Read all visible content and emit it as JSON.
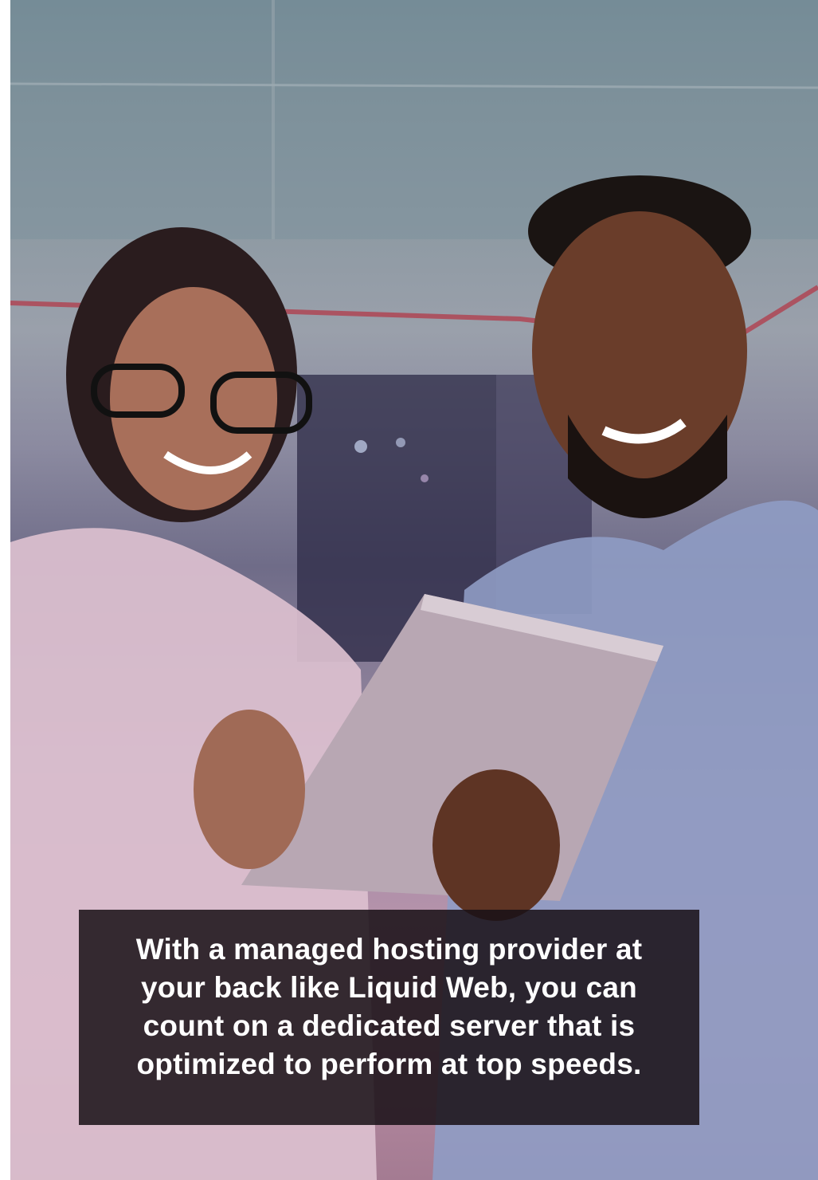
{
  "photo": {
    "subject": "two colleagues looking at a tablet in a server room",
    "icon": "photo-image"
  },
  "caption": {
    "text": "With a managed hosting provider at your back like Liquid Web, you can count on a dedicated server that is optimized to perform at top speeds."
  },
  "colors": {
    "caption_background": "#181016",
    "caption_text": "#ffffff",
    "overlay_top": "#6b8590",
    "overlay_bottom": "#b88ca3"
  }
}
